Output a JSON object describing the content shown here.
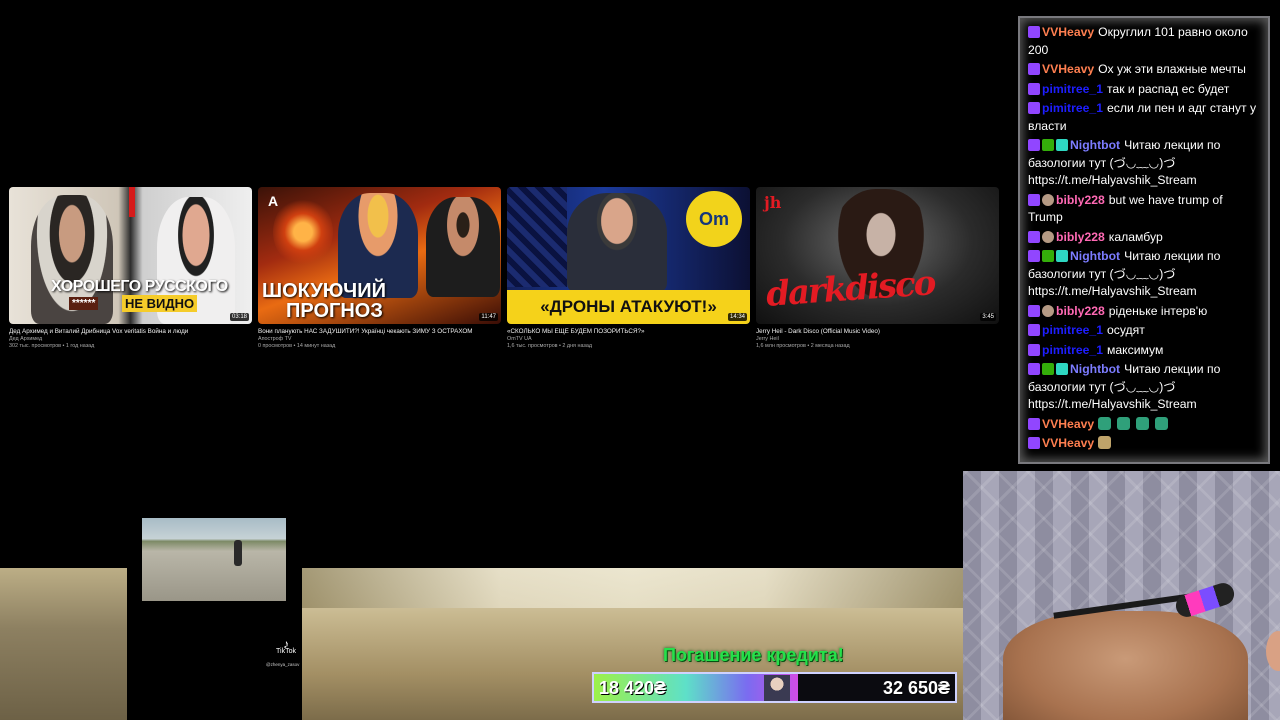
{
  "videos": [
    {
      "title": "Дед Архимед и Виталий Дрибница Vox veritatis Война и люди",
      "channel": "Дед Архимед",
      "meta": "302 тыс. просмотров • 1 год назад",
      "duration": "03:18",
      "overlay_line1": "ХОРОШЕГО РУССКОГО",
      "overlay_stars": "******",
      "overlay_line2": "НЕ ВИДНО"
    },
    {
      "title": "Вони планують НАС ЗАДУШИТИ?! Українці чекають ЗИМУ З ОСТРАХОМ",
      "channel": "Апостроф TV",
      "meta": "0 просмотров • 14 минут назад",
      "duration": "11:47",
      "overlay_line1": "ШОКУЮЧИЙ",
      "overlay_line2": "ПРОГНОЗ",
      "logo": "A"
    },
    {
      "title": "«СКОЛЬКО МЫ ЕЩЁ БУДЕМ ПОЗОРИТЬСЯ?»",
      "channel": "OmTV UA",
      "meta": "1,6 тыс. просмотров • 2 дня назад",
      "duration": "14:34",
      "overlay_line1": "«ДРОНЫ АТАКУЮТ!»",
      "logo": "Om"
    },
    {
      "title": "Jerry Heil - Dark Disco (Official Music Video)",
      "channel": "Jerry Heil",
      "meta": "1,6 млн просмотров • 2 месяца назад",
      "duration": "3:45",
      "overlay_line1": "darkdisco",
      "logo": "jh"
    }
  ],
  "chat": {
    "messages": [
      {
        "badges": [
          "twitch"
        ],
        "user": "VVHeavy",
        "color": "#ff7f50",
        "text": "Округлил 101 равно около 200"
      },
      {
        "badges": [
          "twitch"
        ],
        "user": "VVHeavy",
        "color": "#ff7f50",
        "text": "Ох уж эти влажные мечты"
      },
      {
        "badges": [
          "twitch"
        ],
        "user": "pimitree_1",
        "color": "#1e1eff",
        "text": "так и распад ес будет"
      },
      {
        "badges": [
          "twitch"
        ],
        "user": "pimitree_1",
        "color": "#1e1eff",
        "text": "если ли пен и адг станут у власти"
      },
      {
        "badges": [
          "twitch",
          "mod",
          "bot"
        ],
        "user": "Nightbot",
        "color": "#7c7cff",
        "text": "Читаю лекции по базологии тут (づ◡﹏◡)づ https://t.me/Halyavshik_Stream"
      },
      {
        "badges": [
          "twitch",
          "sub"
        ],
        "user": "bibly228",
        "color": "#ff69b4",
        "text": "but we have trump of Trump"
      },
      {
        "badges": [
          "twitch",
          "sub"
        ],
        "user": "bibly228",
        "color": "#ff69b4",
        "text": "каламбур"
      },
      {
        "badges": [
          "twitch",
          "mod",
          "bot"
        ],
        "user": "Nightbot",
        "color": "#7c7cff",
        "text": "Читаю лекции по базологии тут (づ◡﹏◡)づ https://t.me/Halyavshik_Stream"
      },
      {
        "badges": [
          "twitch",
          "sub"
        ],
        "user": "bibly228",
        "color": "#ff69b4",
        "text": "рiденьке інтерв'ю"
      },
      {
        "badges": [
          "twitch"
        ],
        "user": "pimitree_1",
        "color": "#1e1eff",
        "text": "осудят"
      },
      {
        "badges": [
          "twitch"
        ],
        "user": "pimitree_1",
        "color": "#1e1eff",
        "text": "максимум"
      },
      {
        "badges": [
          "twitch",
          "mod",
          "bot"
        ],
        "user": "Nightbot",
        "color": "#7c7cff",
        "text": "Читаю лекции по базологии тут (づ◡﹏◡)づ https://t.me/Halyavshik_Stream"
      },
      {
        "badges": [
          "twitch"
        ],
        "user": "VVHeavy",
        "color": "#ff7f50",
        "text": "",
        "emotes": [
          "frog-emote",
          "frog-emote",
          "frog-emote",
          "frog-emote"
        ]
      },
      {
        "badges": [
          "twitch"
        ],
        "user": "VVHeavy",
        "color": "#ff7f50",
        "text": "",
        "emotes": [
          "pepe-emote"
        ]
      }
    ]
  },
  "credit": {
    "title": "Погашение кредита!",
    "current": "18 420₴",
    "target": "32 650₴",
    "progress": 0.564,
    "gradient_colors": [
      "#9df04a",
      "#5ee0c8",
      "#7a6cf0",
      "#d14de6"
    ]
  },
  "tiktok": {
    "label": "TikTok",
    "handle": "@zhenya_zasov"
  }
}
